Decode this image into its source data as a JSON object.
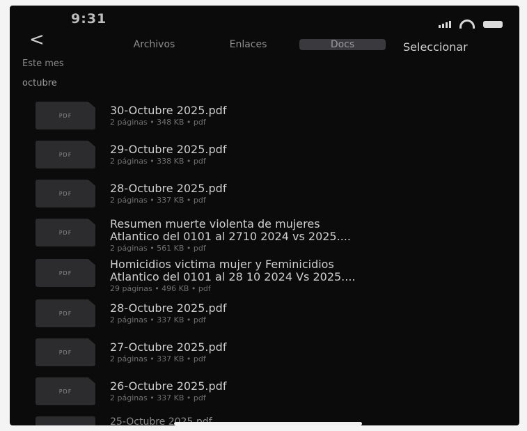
{
  "status": {
    "time": "9:31"
  },
  "nav": {
    "back_glyph": "<",
    "tabs": [
      {
        "label": "Archivos"
      },
      {
        "label": "Enlaces"
      },
      {
        "label": "Docs",
        "active": true
      }
    ],
    "select_label": "Seleccionar"
  },
  "sections": {
    "month": "Este mes",
    "group": "octubre"
  },
  "files": [
    {
      "thumb": "PDF",
      "title": "30-Octubre 2025.pdf",
      "sub": "2 páginas • 348 KB • pdf"
    },
    {
      "thumb": "PDF",
      "title": "29-Octubre 2025.pdf",
      "sub": "2 páginas • 338 KB • pdf"
    },
    {
      "thumb": "PDF",
      "title": "28-Octubre 2025.pdf",
      "sub": "2 páginas • 337 KB • pdf"
    },
    {
      "thumb": "PDF",
      "title": "Resumen muerte violenta de mujeres",
      "title2": "Atlantico del 0101 al 2710 2024 vs 2025....",
      "sub": "2 páginas • 561 KB • pdf"
    },
    {
      "thumb": "PDF",
      "title": "Homicidios victima mujer  y Feminicidios",
      "title2": "Atlantico del 0101 al 28 10 2024 Vs 2025....",
      "sub": "29 páginas • 496 KB • pdf"
    },
    {
      "thumb": "PDF",
      "title": "28-Octubre 2025.pdf",
      "sub": "2 páginas • 337 KB • pdf"
    },
    {
      "thumb": "PDF",
      "title": "27-Octubre 2025.pdf",
      "sub": "2 páginas • 337 KB • pdf"
    },
    {
      "thumb": "PDF",
      "title": "26-Octubre 2025.pdf",
      "sub": "2 páginas • 337 KB • pdf"
    }
  ],
  "partial_item": {
    "title": "25-Octubre 2025.pdf"
  },
  "colors": {
    "background": "#0b0b0c",
    "active_tab": "#3a3a3e",
    "text": "#cfcfcf"
  }
}
